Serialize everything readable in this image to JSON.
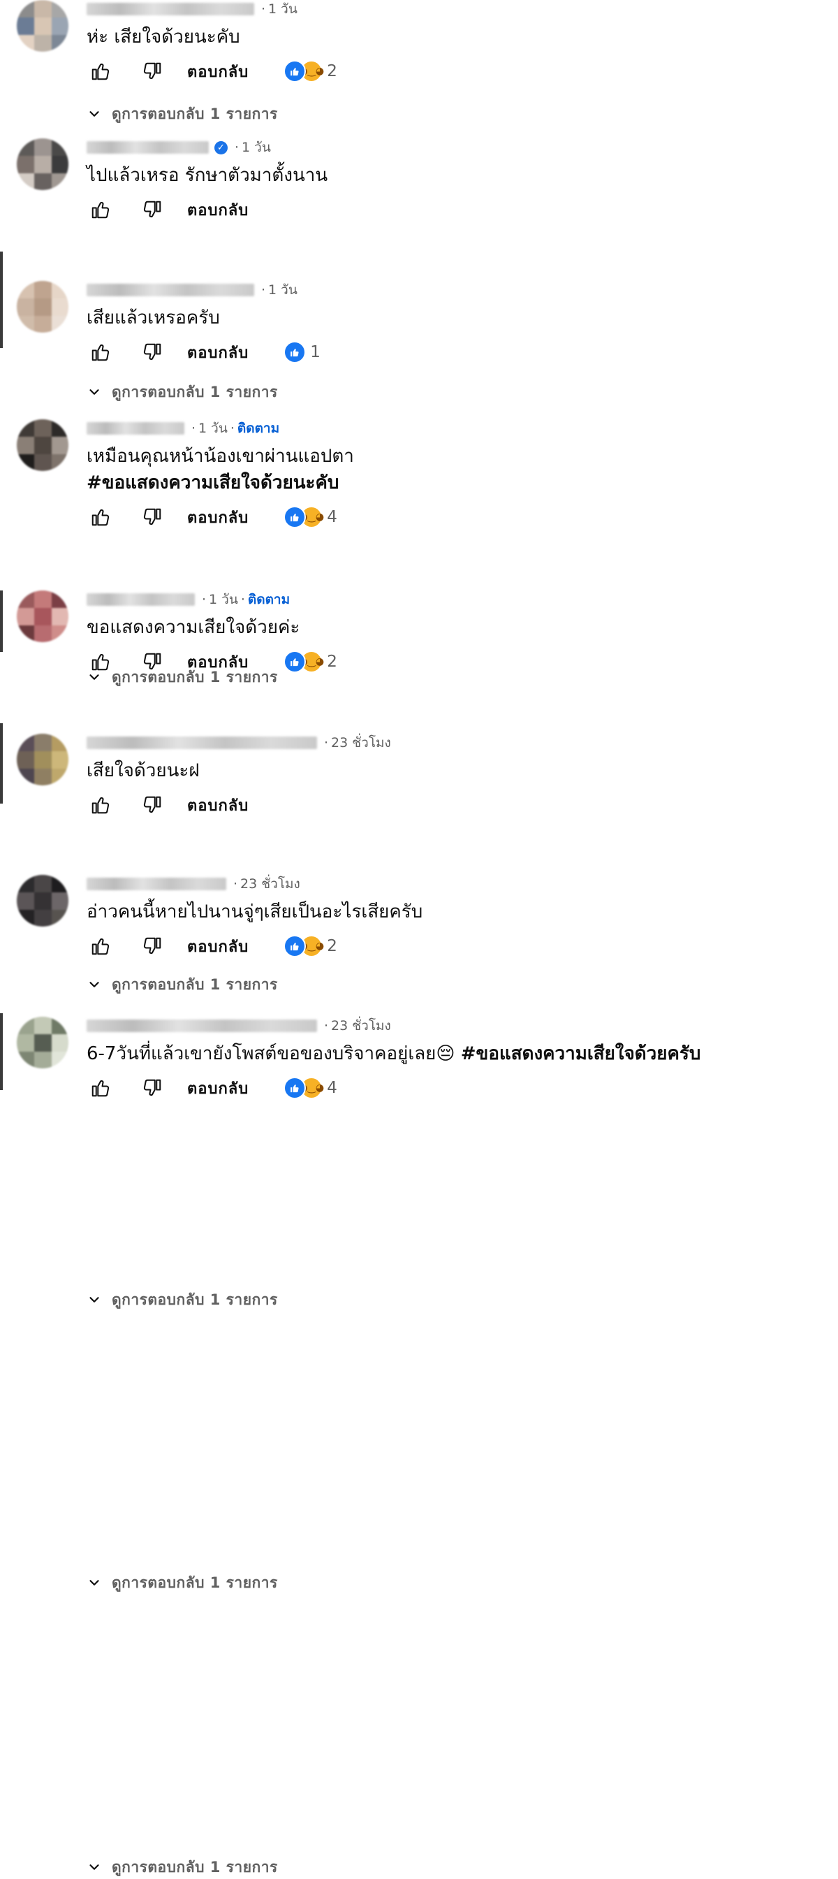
{
  "ui": {
    "reply_label": "ตอบกลับ",
    "view_replies_label": "ดูการตอบกลับ 1 รายการ",
    "accent_color": "#065fd4",
    "like_reaction_color": "#1877f2",
    "care_reaction_color": "#f7b125"
  },
  "comments": [
    {
      "time": "1 วัน",
      "text": "ห่ะ เสียใจด้วยนะคับ",
      "reaction_count": "2"
    },
    {
      "time": "1 วัน",
      "text": "ไปแล้วเหรอ รักษาตัวมาตั้งนาน",
      "verified": true
    },
    {
      "time": "1 วัน",
      "text": "เสียแล้วเหรอครับ",
      "reaction_count": "1"
    },
    {
      "time": "1 วัน",
      "follow": "ติดตาม",
      "text": "เหมือนคุณหน้าน้องเขาผ่านแอปตา",
      "hashtag": "#ขอแสดงความเสียใจด้วยนะคับ",
      "reaction_count": "4"
    },
    {
      "time": "1 วัน",
      "follow": "ติดตาม",
      "text": "ขอแสดงความเสียใจด้วยค่ะ",
      "reaction_count": "2"
    },
    {
      "time": "23 ชั่วโมง",
      "text": "เสียใจด้วยนะฝ"
    },
    {
      "time": "23 ชั่วโมง",
      "text": "อ่าวคนนี้หายไปนานจู่ๆเสียเป็นอะไรเสียครับ",
      "reaction_count": "2"
    },
    {
      "time": "23 ชั่วโมง",
      "text": "6-7วันที่แล้วเขายังโพสต์ขอของบริจาคอยู่เลย😔",
      "hashtag": "#ขอแสดงความเสียใจด้วยครับ",
      "reaction_count": "4"
    }
  ]
}
